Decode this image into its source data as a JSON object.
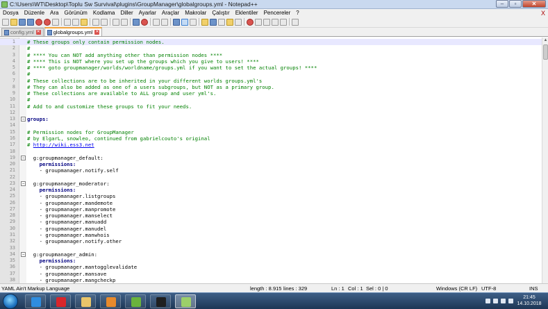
{
  "window": {
    "title": "C:\\Users\\WT\\Desktop\\Toplu Sw Survival\\plugins\\GroupManager\\globalgroups.yml - Notepad++",
    "buttons": {
      "minimize": "–",
      "maximize": "▫",
      "close": "✕"
    }
  },
  "menu": {
    "items": [
      "Dosya",
      "Düzenle",
      "Ara",
      "Görünüm",
      "Kodlama",
      "Diller",
      "Ayarlar",
      "Araçlar",
      "Makrolar",
      "Çalıştır",
      "Eklentiler",
      "Pencereler",
      "?"
    ],
    "close_doc": "X"
  },
  "tabs": [
    {
      "label": "config.yml",
      "active": false
    },
    {
      "label": "globalgroups.yml",
      "active": true
    }
  ],
  "editor": {
    "current_line": 1,
    "lines": [
      {
        "n": "1",
        "text": "# These groups only contain permission nodes.",
        "kind": "comment",
        "fold": ""
      },
      {
        "n": "2",
        "text": "#",
        "kind": "comment",
        "fold": ""
      },
      {
        "n": "3",
        "text": "# **** You can NOT add anything other than permission nodes ****",
        "kind": "comment",
        "fold": ""
      },
      {
        "n": "4",
        "text": "# **** This is NOT where you set up the groups which you give to users! ****",
        "kind": "comment",
        "fold": ""
      },
      {
        "n": "5",
        "text": "# **** goto groupmanager/worlds/worldname/groups.yml if you want to set the actual groups! ****",
        "kind": "comment",
        "fold": ""
      },
      {
        "n": "6",
        "text": "#",
        "kind": "comment",
        "fold": ""
      },
      {
        "n": "7",
        "text": "# These collections are to be inherited in your different worlds groups.yml's",
        "kind": "comment",
        "fold": ""
      },
      {
        "n": "8",
        "text": "# They can also be added as one of a users subgroups, but NOT as a primary group.",
        "kind": "comment",
        "fold": ""
      },
      {
        "n": "9",
        "text": "# These collections are available to ALL group and user yml's.",
        "kind": "comment",
        "fold": ""
      },
      {
        "n": "10",
        "text": "#",
        "kind": "comment",
        "fold": ""
      },
      {
        "n": "11",
        "text": "# Add to and customize these groups to fit your needs.",
        "kind": "comment",
        "fold": ""
      },
      {
        "n": "12",
        "text": "",
        "kind": "plain",
        "fold": ""
      },
      {
        "n": "13",
        "text": "groups:",
        "kind": "key",
        "fold": "−"
      },
      {
        "n": "14",
        "text": "",
        "kind": "plain",
        "fold": ""
      },
      {
        "n": "15",
        "text": "# Permission nodes for GroupManager",
        "kind": "comment",
        "fold": ""
      },
      {
        "n": "16",
        "text": "# by ElgarL, snowleo, continued from gabrielcouto's original",
        "kind": "comment",
        "fold": ""
      },
      {
        "n": "17",
        "text": "# http://wiki.ess3.net",
        "kind": "comment-url",
        "fold": ""
      },
      {
        "n": "18",
        "text": "",
        "kind": "plain",
        "fold": ""
      },
      {
        "n": "19",
        "text": "  g:groupmanager_default:",
        "kind": "plain",
        "fold": "−"
      },
      {
        "n": "20",
        "text": "    permissions:",
        "kind": "key",
        "fold": ""
      },
      {
        "n": "21",
        "text": "    - groupmanager.notify.self",
        "kind": "plain",
        "fold": ""
      },
      {
        "n": "22",
        "text": "",
        "kind": "plain",
        "fold": ""
      },
      {
        "n": "23",
        "text": "  g:groupmanager_moderator:",
        "kind": "plain",
        "fold": "−"
      },
      {
        "n": "24",
        "text": "    permissions:",
        "kind": "key",
        "fold": ""
      },
      {
        "n": "25",
        "text": "    - groupmanager.listgroups",
        "kind": "plain",
        "fold": ""
      },
      {
        "n": "26",
        "text": "    - groupmanager.mandemote",
        "kind": "plain",
        "fold": ""
      },
      {
        "n": "27",
        "text": "    - groupmanager.manpromote",
        "kind": "plain",
        "fold": ""
      },
      {
        "n": "28",
        "text": "    - groupmanager.manselect",
        "kind": "plain",
        "fold": ""
      },
      {
        "n": "29",
        "text": "    - groupmanager.manuadd",
        "kind": "plain",
        "fold": ""
      },
      {
        "n": "30",
        "text": "    - groupmanager.manudel",
        "kind": "plain",
        "fold": ""
      },
      {
        "n": "31",
        "text": "    - groupmanager.manwhois",
        "kind": "plain",
        "fold": ""
      },
      {
        "n": "32",
        "text": "    - groupmanager.notify.other",
        "kind": "plain",
        "fold": ""
      },
      {
        "n": "33",
        "text": "",
        "kind": "plain",
        "fold": ""
      },
      {
        "n": "34",
        "text": "  g:groupmanager_admin:",
        "kind": "plain",
        "fold": "−"
      },
      {
        "n": "35",
        "text": "    permissions:",
        "kind": "key",
        "fold": ""
      },
      {
        "n": "36",
        "text": "    - groupmanager.mantogglevalidate",
        "kind": "plain",
        "fold": ""
      },
      {
        "n": "37",
        "text": "    - groupmanager.mansave",
        "kind": "plain",
        "fold": ""
      },
      {
        "n": "38",
        "text": "    - groupmanager.mangcheckp",
        "kind": "plain",
        "fold": ""
      }
    ]
  },
  "status": {
    "language": "YAML Ain't Markup Language",
    "length": "length : 8.915",
    "lines": "lines : 329",
    "ln": "Ln : 1",
    "col": "Col : 1",
    "sel": "Sel : 0 | 0",
    "eol": "Windows (CR LF)",
    "encoding": "UTF-8",
    "mode": "INS"
  },
  "taskbar": {
    "apps": [
      {
        "name": "internet-explorer",
        "color": "#2f8de0"
      },
      {
        "name": "opera",
        "color": "#d8262b"
      },
      {
        "name": "file-explorer",
        "color": "#e9c56a"
      },
      {
        "name": "media-player",
        "color": "#e88a2c"
      },
      {
        "name": "utorrent",
        "color": "#6ab33d"
      },
      {
        "name": "command-prompt",
        "color": "#202020"
      },
      {
        "name": "notepad-plus-plus",
        "color": "#9ccf6a"
      }
    ],
    "clock": {
      "time": "21:45",
      "date": "14.10.2018"
    }
  }
}
